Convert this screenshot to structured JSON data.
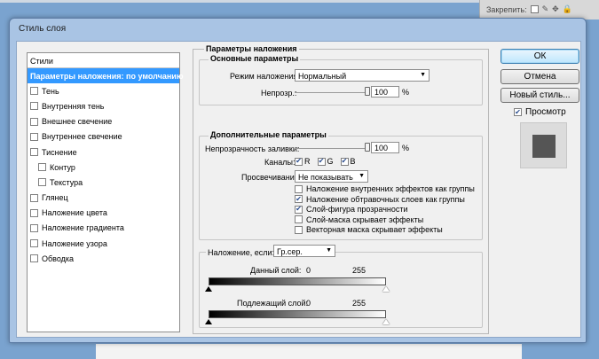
{
  "background": {
    "panel_label": "Закрепить:"
  },
  "dialog": {
    "title": "Стиль слоя"
  },
  "styles_list": {
    "header": "Стили",
    "items": [
      {
        "label": "Параметры наложения: по умолчанию",
        "selected": true,
        "has_checkbox": false,
        "sub": false
      },
      {
        "label": "Тень",
        "selected": false,
        "has_checkbox": true,
        "checked": false,
        "sub": false
      },
      {
        "label": "Внутренняя тень",
        "selected": false,
        "has_checkbox": true,
        "checked": false,
        "sub": false
      },
      {
        "label": "Внешнее свечение",
        "selected": false,
        "has_checkbox": true,
        "checked": false,
        "sub": false
      },
      {
        "label": "Внутреннее свечение",
        "selected": false,
        "has_checkbox": true,
        "checked": false,
        "sub": false
      },
      {
        "label": "Тиснение",
        "selected": false,
        "has_checkbox": true,
        "checked": false,
        "sub": false
      },
      {
        "label": "Контур",
        "selected": false,
        "has_checkbox": true,
        "checked": false,
        "sub": true
      },
      {
        "label": "Текстура",
        "selected": false,
        "has_checkbox": true,
        "checked": false,
        "sub": true
      },
      {
        "label": "Глянец",
        "selected": false,
        "has_checkbox": true,
        "checked": false,
        "sub": false
      },
      {
        "label": "Наложение цвета",
        "selected": false,
        "has_checkbox": true,
        "checked": false,
        "sub": false
      },
      {
        "label": "Наложение градиента",
        "selected": false,
        "has_checkbox": true,
        "checked": false,
        "sub": false
      },
      {
        "label": "Наложение узора",
        "selected": false,
        "has_checkbox": true,
        "checked": false,
        "sub": false
      },
      {
        "label": "Обводка",
        "selected": false,
        "has_checkbox": true,
        "checked": false,
        "sub": false
      }
    ]
  },
  "blending": {
    "title": "Параметры наложения",
    "general": {
      "title": "Основные параметры",
      "mode_label": "Режим наложения:",
      "mode_value": "Нормальный",
      "opacity_label": "Непрозр.:",
      "opacity_value": "100",
      "opacity_unit": "%",
      "opacity_level": 1.0
    },
    "advanced": {
      "title": "Дополнительные параметры",
      "fill_opacity_label": "Непрозрачность заливки:",
      "fill_opacity_value": "100",
      "fill_opacity_unit": "%",
      "fill_opacity_level": 1.0,
      "channels_label": "Каналы:",
      "channels": [
        {
          "label": "R",
          "checked": true
        },
        {
          "label": "G",
          "checked": true
        },
        {
          "label": "B",
          "checked": true
        }
      ],
      "knockout_label": "Просвечивание:",
      "knockout_value": "Не показывать",
      "options": [
        {
          "label": "Наложение внутренних эффектов как группы",
          "checked": false
        },
        {
          "label": "Наложение обтравочных слоев как группы",
          "checked": true
        },
        {
          "label": "Слой-фигура прозрачности",
          "checked": true
        },
        {
          "label": "Слой-маска скрывает эффекты",
          "checked": false
        },
        {
          "label": "Векторная маска скрывает эффекты",
          "checked": false
        }
      ]
    },
    "blend_if": {
      "label": "Наложение, если:",
      "value": "Гр.сер.",
      "this_layer_label": "Данный слой:",
      "this_layer_min": "0",
      "this_layer_max": "255",
      "underlying_label": "Подлежащий слой:",
      "underlying_min": "0",
      "underlying_max": "255"
    }
  },
  "buttons": {
    "ok": "ОК",
    "cancel": "Отмена",
    "new_style": "Новый стиль...",
    "preview_label": "Просмотр",
    "preview_checked": true
  },
  "colors": {
    "selection": "#3399ff",
    "window_frame": "#a9c4e4",
    "preview_swatch": "#555555"
  }
}
